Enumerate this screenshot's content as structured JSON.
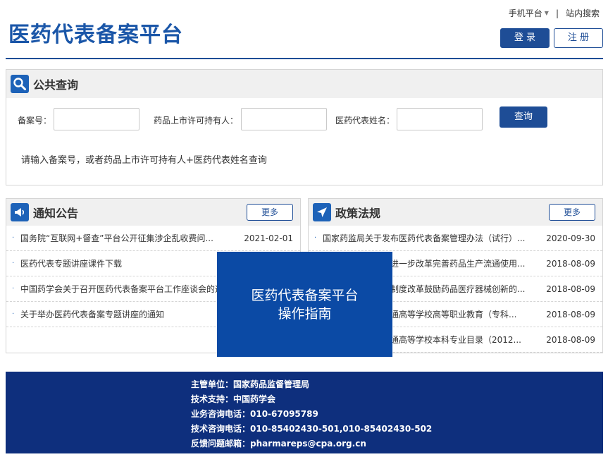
{
  "header": {
    "title": "医药代表备案平台",
    "mobile_link": "手机平台",
    "separator": "|",
    "site_search": "站内搜索",
    "login": "登 录",
    "register": "注 册"
  },
  "search": {
    "title": "公共查询",
    "fields": [
      {
        "label": "备案号：",
        "value": ""
      },
      {
        "label": "药品上市许可持有人：",
        "value": ""
      },
      {
        "label": "医药代表姓名：",
        "value": ""
      }
    ],
    "button": "查询",
    "hint": "请输入备案号，或者药品上市许可持有人+医药代表姓名查询"
  },
  "notices": {
    "title": "通知公告",
    "more": "更多",
    "items": [
      {
        "text": "国务院“互联网+督查”平台公开征集涉企乱收费问...",
        "date": "2021-02-01"
      },
      {
        "text": "医药代表专题讲座课件下载",
        "date": ""
      },
      {
        "text": "中国药学会关于召开医药代表备案平台工作座谈会的通知",
        "date": ""
      },
      {
        "text": "关于举办医药代表备案专题讲座的通知",
        "date": ""
      }
    ]
  },
  "policies": {
    "title": "政策法规",
    "more": "更多",
    "items": [
      {
        "text": "国家药监局关于发布医药代表备案管理办法（试行）...",
        "date": "2020-09-30"
      },
      {
        "text": "国务院办公厅关于进一步改革完善药品生产流通使用...",
        "date": "2018-08-09"
      },
      {
        "text": "关于深化审评审批制度改革鼓励药品医疗器械创新的...",
        "date": "2018-08-09"
      },
      {
        "text": "教育部关于印发普通高等学校高等职业教育（专科...",
        "date": "2018-08-09"
      },
      {
        "text": "教育部关于印发普通高等学校本科专业目录（2012...",
        "date": "2018-08-09"
      }
    ]
  },
  "guide": {
    "line1": "医药代表备案平台",
    "line2": "操作指南"
  },
  "footer": {
    "lines": [
      "主管单位：国家药品监督管理局",
      "技术支持：中国药学会",
      "业务咨询电话：010-67095789",
      "技术咨询电话：010-85402430-501,010-85402430-502",
      "反馈问题邮箱：pharmareps@cpa.org.cn"
    ]
  },
  "colors": {
    "brand": "#1a56a8",
    "button": "#1e4d96",
    "footer": "#0e2f7d",
    "overlay": "#0b4aa5"
  }
}
